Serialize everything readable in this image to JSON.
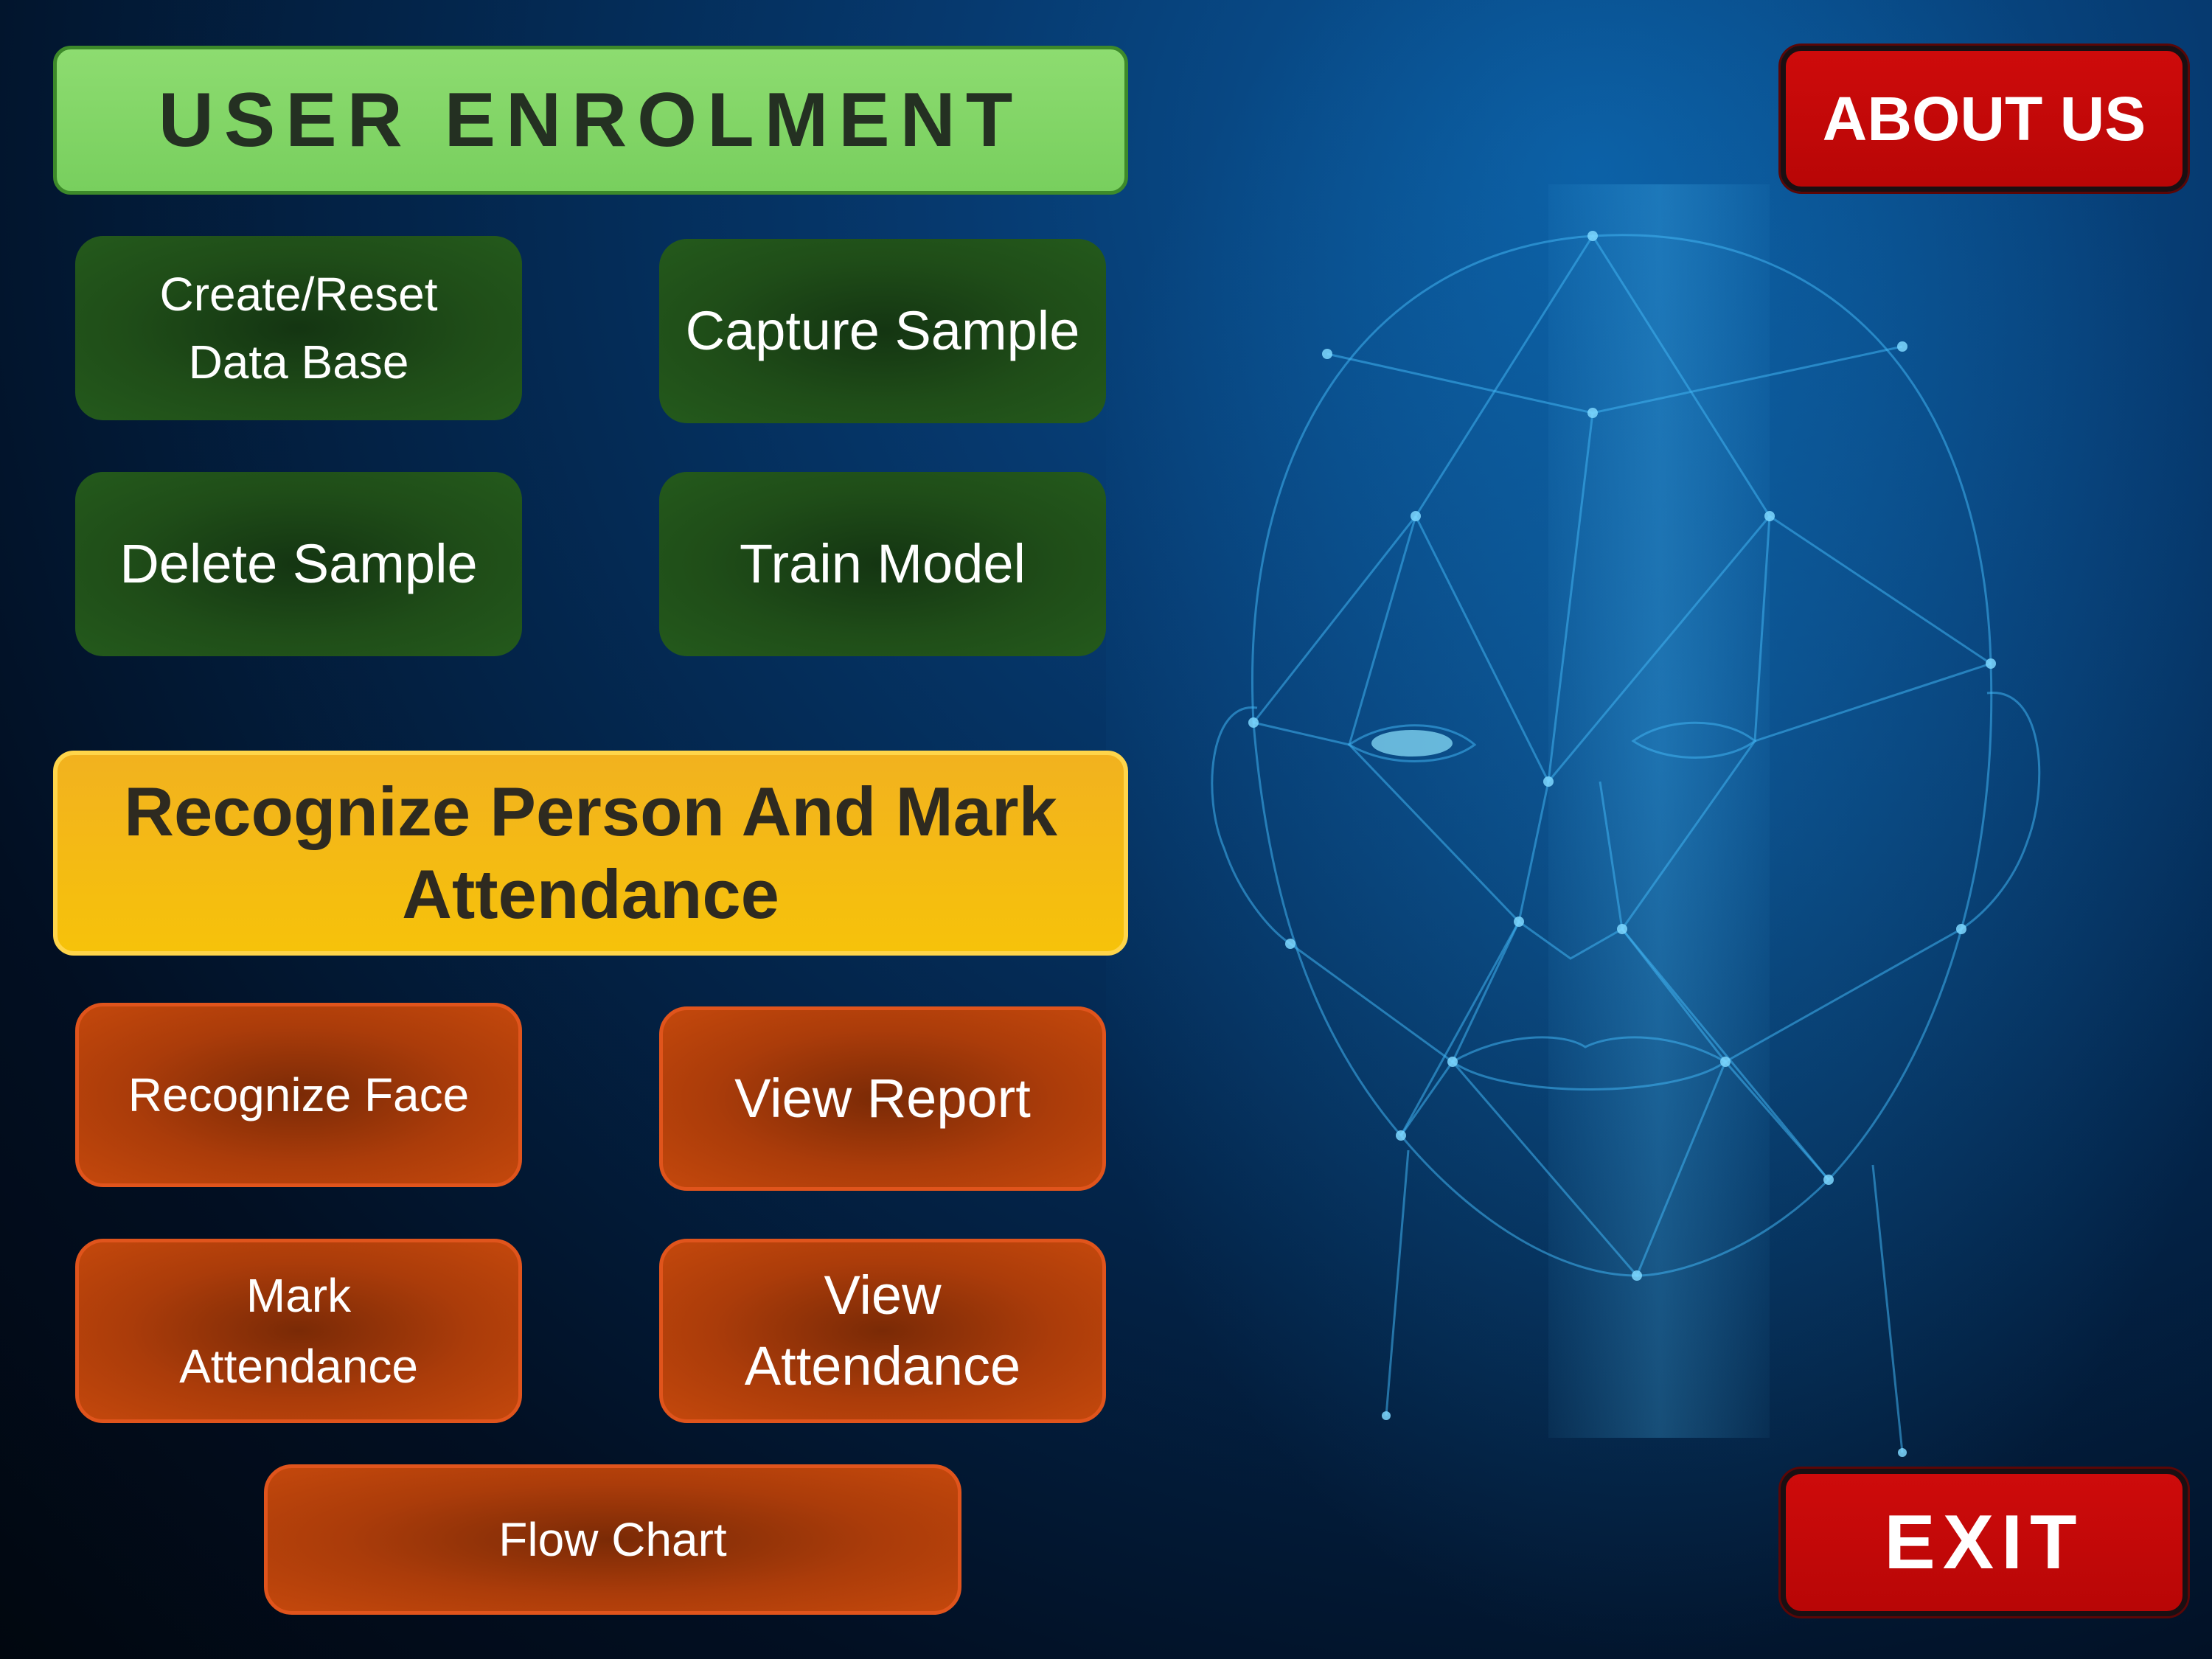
{
  "enrolment": {
    "title": "USER ENROLMENT",
    "create_reset": "Create/Reset\nData Base",
    "capture_sample": "Capture Sample",
    "delete_sample": "Delete Sample",
    "train_model": "Train Model"
  },
  "attendance": {
    "title": "Recognize Person And  Mark\nAttendance",
    "recognize_face": "Recognize Face",
    "view_report": "View Report",
    "mark_attendance": "Mark\nAttendance",
    "view_attendance": "View\nAttendance",
    "flow_chart": "Flow Chart"
  },
  "top_right": {
    "about_us": "ABOUT US"
  },
  "bottom_right": {
    "exit": "EXIT"
  },
  "colors": {
    "enrolment_green": "#7fd465",
    "attendance_yellow": "#f4bb14",
    "action_green": "#1f4d18",
    "action_orange": "#c4480c",
    "danger_red": "#c00808",
    "background_blue": "#063a70"
  },
  "background_image": {
    "icon": "face-mesh-icon"
  }
}
